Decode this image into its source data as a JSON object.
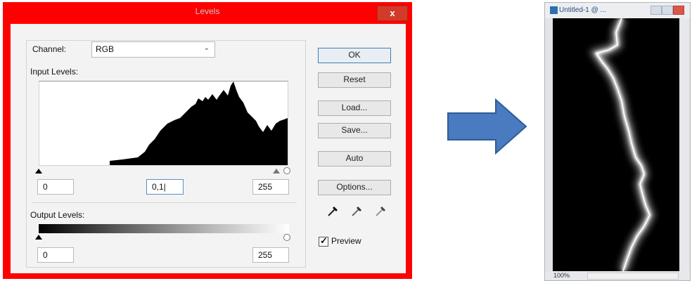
{
  "dialog": {
    "title": "Levels",
    "close_label": "x",
    "channel": {
      "label": "Channel:",
      "value": "RGB"
    },
    "input_levels": {
      "label": "Input Levels:",
      "black": "0",
      "gamma": "0,1|",
      "white": "255"
    },
    "output_levels": {
      "label": "Output Levels:",
      "black": "0",
      "white": "255"
    },
    "buttons": {
      "ok": "OK",
      "reset": "Reset",
      "load": "Load...",
      "save": "Save...",
      "auto": "Auto",
      "options": "Options..."
    },
    "preview": {
      "label": "Preview",
      "checked": true
    }
  },
  "arrow": {
    "color": "#4a7ac0"
  },
  "document": {
    "title": "Untitled-1 @ ...",
    "zoom": "100%"
  },
  "colors": {
    "accent_red": "#ff0000",
    "arrow_blue": "#4a7ac0"
  }
}
